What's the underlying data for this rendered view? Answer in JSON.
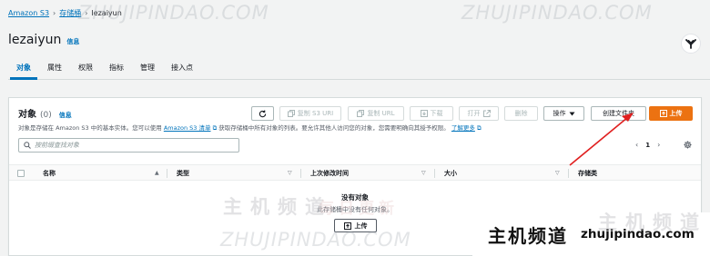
{
  "breadcrumb": {
    "root": "Amazon S3",
    "section": "存储桶",
    "current": "lezaiyun"
  },
  "bucket": {
    "name": "lezaiyun",
    "info_link": "信息"
  },
  "tabs": [
    {
      "label": "对象",
      "active": true
    },
    {
      "label": "属性",
      "active": false
    },
    {
      "label": "权限",
      "active": false
    },
    {
      "label": "指标",
      "active": false
    },
    {
      "label": "管理",
      "active": false
    },
    {
      "label": "接入点",
      "active": false
    }
  ],
  "objects_panel": {
    "title": "对象",
    "count": "(0)",
    "info_link": "信息",
    "description_pre": "对象是存储在 Amazon S3 中的基本实体。您可以使用",
    "description_link": "Amazon S3 清单",
    "description_mid": "获取存储桶中所有对象的列表。要允许其他人访问您的对象，您需要明确向其授予权限。",
    "description_more": "了解更多",
    "toolbar": {
      "copy_s3_uri": "复制 S3 URI",
      "copy_url": "复制 URL",
      "download": "下载",
      "open": "打开",
      "delete": "删除",
      "actions": "操作",
      "create_folder": "创建文件夹",
      "upload": "上传"
    },
    "search_placeholder": "按前缀查找对象",
    "pagination": {
      "current_page": "1"
    },
    "columns": [
      "名称",
      "类型",
      "上次修改时间",
      "大小",
      "存储类"
    ],
    "empty_state": {
      "title": "没有对象",
      "message": "此存储桶中没有任何对象。",
      "upload_label": "上传"
    }
  },
  "watermarks": {
    "url_upper": "ZHUJIPINDAO.COM",
    "cn_mid": "主机频道",
    "cn_mid_tail": "每日更新",
    "url_lower": "ZHUJIPINDAO.COM",
    "brand_cn": "主机频道",
    "brand_url": "zhujipindao.com",
    "brand_tail": "主机频道"
  },
  "colors": {
    "link": "#0073bb",
    "primary": "#ec7211",
    "annotation_arrow": "#e01f1f"
  }
}
